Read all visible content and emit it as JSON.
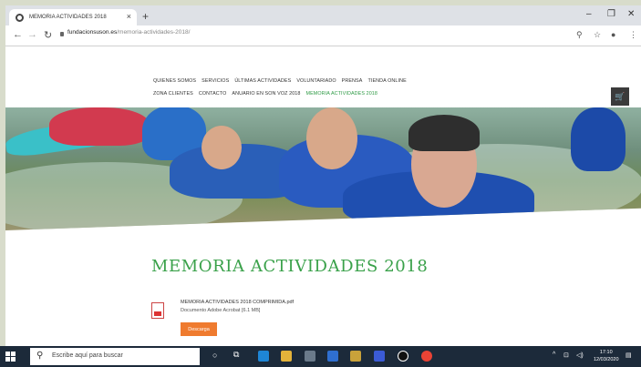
{
  "browser": {
    "tab_title": "MEMORIA ACTIVIDADES 2018",
    "tab_close": "×",
    "new_tab": "+",
    "url_host": "fundacionsuson.es",
    "url_path": "/memoria-actividades-2018/",
    "window_controls": [
      "–",
      "❐",
      "✕"
    ]
  },
  "nav": {
    "row1": [
      "QUIENES SOMOS",
      "SERVICIOS",
      "ÚLTIMAS ACTIVIDADES",
      "VOLUNTARIADO",
      "PRENSA",
      "TIENDA ONLINE"
    ],
    "row2": [
      "ZONA CLIENTES",
      "CONTACTO",
      "ANUARIO EN SON VOZ 2018",
      "MEMORIA ACTIVIDADES 2018"
    ],
    "active": "MEMORIA ACTIVIDADES 2018"
  },
  "cart_icon": "cart-icon",
  "page": {
    "heading": "MEMORIA ACTIVIDADES 2018",
    "file_name": "MEMORIA ACTIVIDADES 2018 COMPRIMIDA.pdf",
    "file_meta": "Documento Adobe Acrobat [6.1 MB]",
    "download_label": "Descarga"
  },
  "taskbar": {
    "search_placeholder": "Escribe aquí para buscar",
    "time": "17:10",
    "date": "12/03/2020"
  },
  "colors": {
    "accent_green": "#3aa14a",
    "download_orange": "#ef7b2f",
    "taskbar": "#1c2a3a"
  }
}
